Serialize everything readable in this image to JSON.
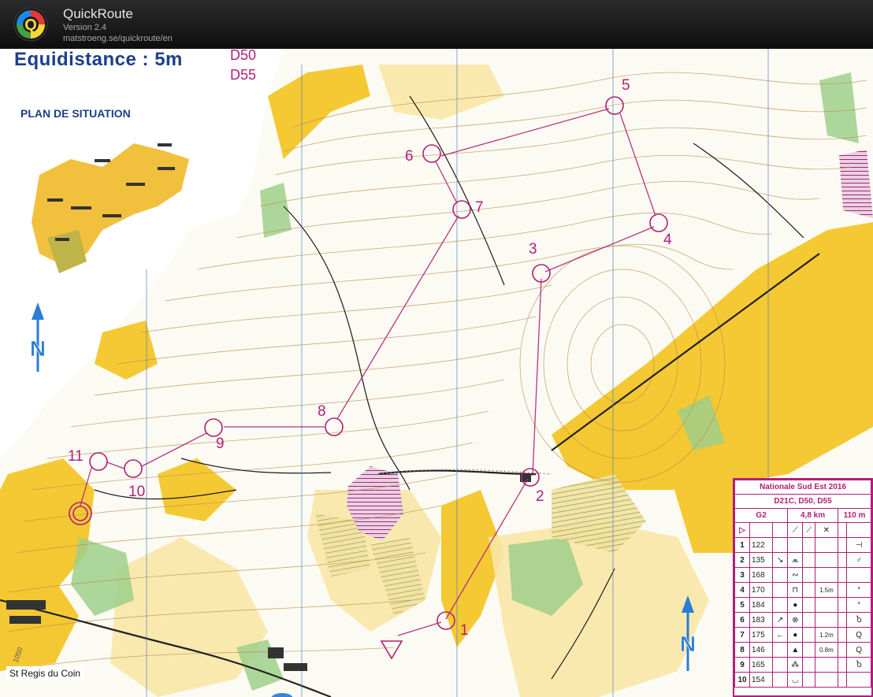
{
  "app": {
    "name": "QuickRoute",
    "version": "Version 2.4",
    "url": "matstroeng.se/quickroute/en"
  },
  "map": {
    "equidistance": "Equidistance : 5m",
    "courses": [
      "D50",
      "D55"
    ],
    "plan_title": "PLAN DE SITUATION",
    "town": "St Regis du Coin",
    "controls": [
      "1",
      "2",
      "3",
      "4",
      "5",
      "6",
      "7",
      "8",
      "9",
      "10",
      "11"
    ]
  },
  "description_sheet": {
    "event": "Nationale Sud Est 2016",
    "classes": "D21C, D50, D55",
    "course": "G2",
    "length": "4,8 km",
    "climb": "110 m",
    "rows": [
      {
        "n": "1",
        "code": "122",
        "c": "",
        "d": "",
        "e": "",
        "f": "",
        "g": "⊣"
      },
      {
        "n": "2",
        "code": "135",
        "c": "↘",
        "d": "⩕",
        "e": "",
        "f": "",
        "g": "♂"
      },
      {
        "n": "3",
        "code": "168",
        "c": "",
        "d": "∾",
        "e": "",
        "f": "",
        "g": ""
      },
      {
        "n": "4",
        "code": "170",
        "c": "",
        "d": "⊓",
        "e": "",
        "f": "1.5m",
        "g": "ᐤ"
      },
      {
        "n": "5",
        "code": "184",
        "c": "",
        "d": "●",
        "e": "",
        "f": "",
        "g": "ᐤ"
      },
      {
        "n": "6",
        "code": "183",
        "c": "↗",
        "d": "⊗",
        "e": "",
        "f": "",
        "g": "Ⴆ"
      },
      {
        "n": "7",
        "code": "175",
        "c": "←",
        "d": "●",
        "e": "",
        "f": "1.2m",
        "g": "Q"
      },
      {
        "n": "8",
        "code": "146",
        "c": "",
        "d": "▲",
        "e": "",
        "f": "0.8m",
        "g": "Q"
      },
      {
        "n": "9",
        "code": "165",
        "c": "",
        "d": "⁂",
        "e": "",
        "f": "",
        "g": "Ⴆ"
      },
      {
        "n": "10",
        "code": "154",
        "c": "",
        "d": "◡",
        "e": "",
        "f": "",
        "g": ""
      }
    ]
  },
  "colors": {
    "course": "#b01f78",
    "open": "#f3c423",
    "rough": "#f8e7a6",
    "green": "#9fcf8a",
    "contour": "#c08a4a",
    "title_blue": "#1d3f8a"
  }
}
